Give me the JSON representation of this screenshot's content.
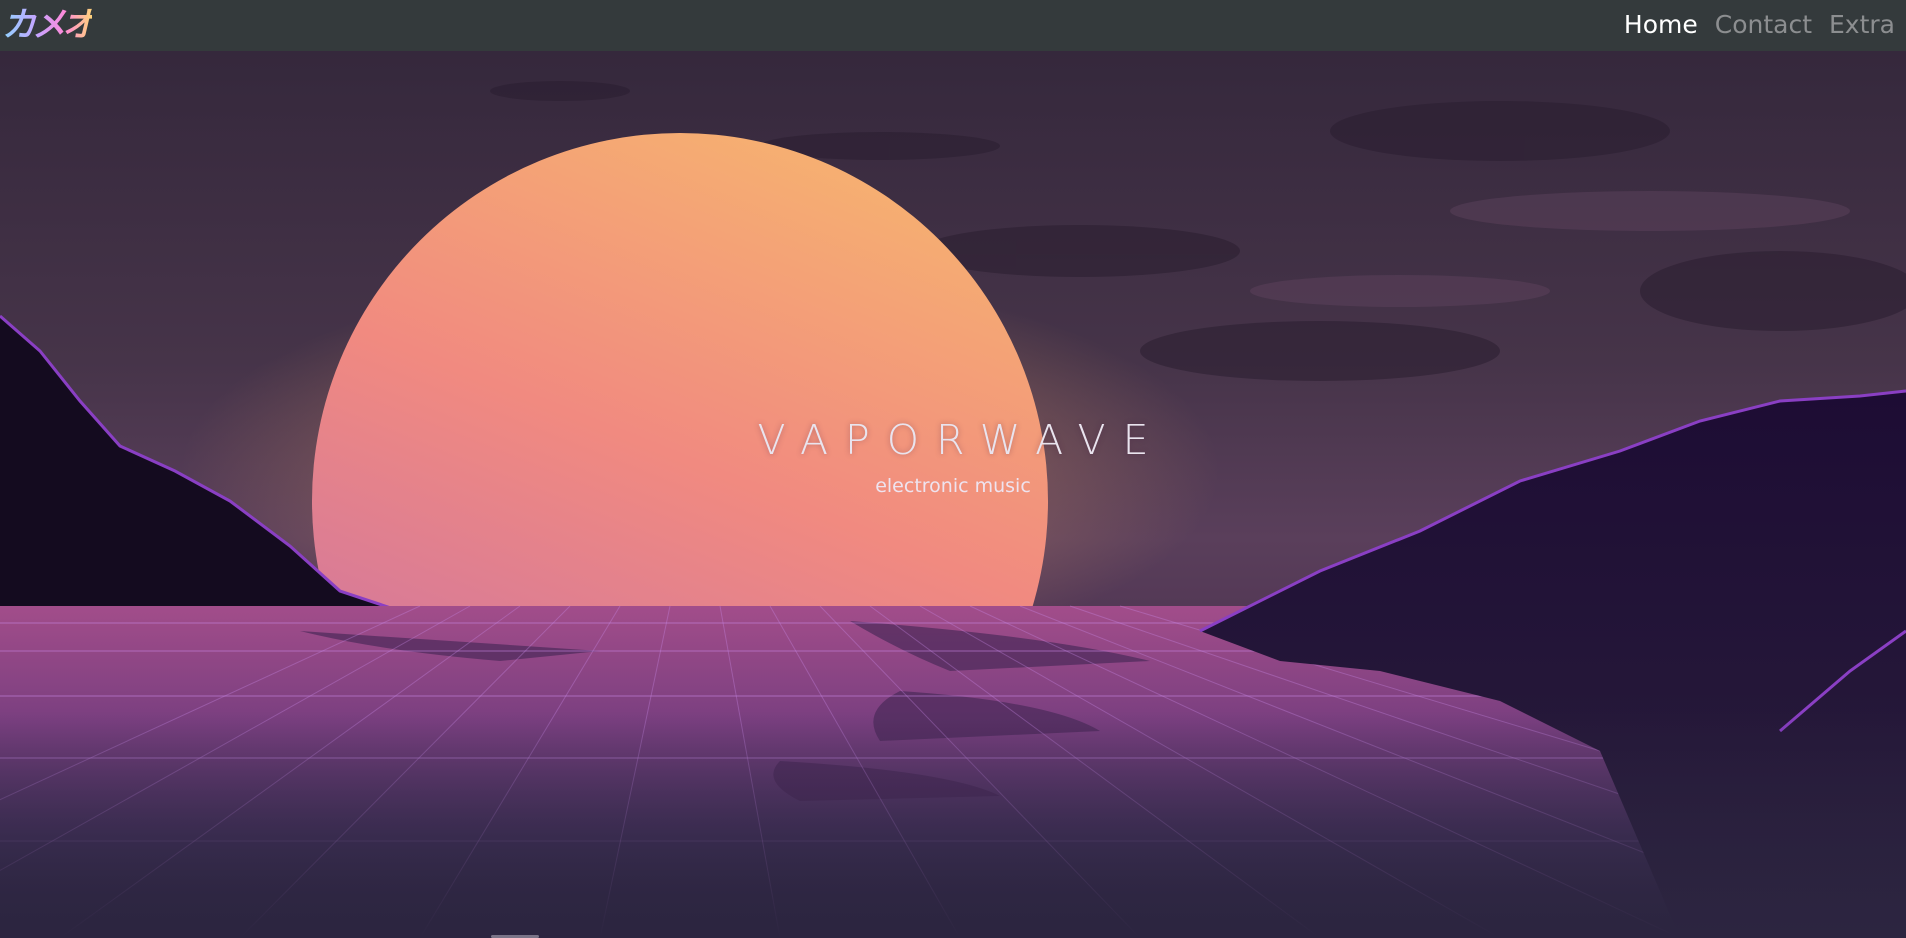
{
  "navbar": {
    "logo_text": "カメオ",
    "links": [
      {
        "label": "Home",
        "active": true
      },
      {
        "label": "Contact",
        "active": false
      },
      {
        "label": "Extra",
        "active": false
      }
    ]
  },
  "hero": {
    "title": "VAPORWAVE",
    "subtitle": "electronic music"
  },
  "colors": {
    "navbar_bg": "#343a3c",
    "sky_top": "#3a2d44",
    "sun_top": "#f6b36e",
    "sun_bottom": "#c9729b",
    "grid_line": "#c98ae8",
    "mountain": "#1a0f2a"
  }
}
